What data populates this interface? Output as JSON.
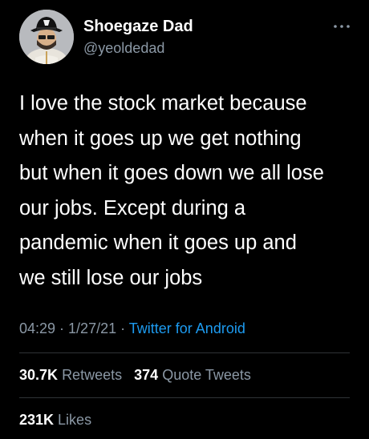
{
  "author": {
    "display_name": "Shoegaze Dad",
    "handle": "@yeoldedad"
  },
  "tweet": {
    "text": "I love the stock market because\nwhen it goes up we get nothing\nbut when it goes down we all lose\nour jobs. Except during a\npandemic when it goes up and\nwe still lose our jobs",
    "time": "04:29",
    "separator": " · ",
    "date": "1/27/21",
    "source": "Twitter for Android"
  },
  "stats": {
    "retweets_count": "30.7K",
    "retweets_label": "Retweets",
    "quotes_count": "374",
    "quotes_label": "Quote Tweets",
    "likes_count": "231K",
    "likes_label": "Likes"
  },
  "icons": {
    "avatar": "profile-photo",
    "more": "more-options-icon"
  },
  "colors": {
    "background": "#000000",
    "primary_text": "#ffffff",
    "secondary_text": "#8b98a5",
    "link": "#1d9bf0",
    "divider": "#2f3336"
  }
}
